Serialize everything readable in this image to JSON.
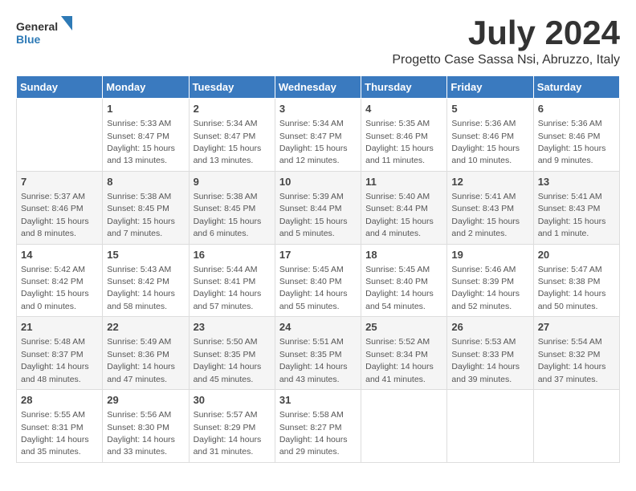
{
  "logo": {
    "line1": "General",
    "line2": "Blue"
  },
  "title": "July 2024",
  "subtitle": "Progetto Case Sassa Nsi, Abruzzo, Italy",
  "days_of_week": [
    "Sunday",
    "Monday",
    "Tuesday",
    "Wednesday",
    "Thursday",
    "Friday",
    "Saturday"
  ],
  "weeks": [
    [
      {
        "day": "",
        "info": ""
      },
      {
        "day": "1",
        "info": "Sunrise: 5:33 AM\nSunset: 8:47 PM\nDaylight: 15 hours\nand 13 minutes."
      },
      {
        "day": "2",
        "info": "Sunrise: 5:34 AM\nSunset: 8:47 PM\nDaylight: 15 hours\nand 13 minutes."
      },
      {
        "day": "3",
        "info": "Sunrise: 5:34 AM\nSunset: 8:47 PM\nDaylight: 15 hours\nand 12 minutes."
      },
      {
        "day": "4",
        "info": "Sunrise: 5:35 AM\nSunset: 8:46 PM\nDaylight: 15 hours\nand 11 minutes."
      },
      {
        "day": "5",
        "info": "Sunrise: 5:36 AM\nSunset: 8:46 PM\nDaylight: 15 hours\nand 10 minutes."
      },
      {
        "day": "6",
        "info": "Sunrise: 5:36 AM\nSunset: 8:46 PM\nDaylight: 15 hours\nand 9 minutes."
      }
    ],
    [
      {
        "day": "7",
        "info": "Sunrise: 5:37 AM\nSunset: 8:46 PM\nDaylight: 15 hours\nand 8 minutes."
      },
      {
        "day": "8",
        "info": "Sunrise: 5:38 AM\nSunset: 8:45 PM\nDaylight: 15 hours\nand 7 minutes."
      },
      {
        "day": "9",
        "info": "Sunrise: 5:38 AM\nSunset: 8:45 PM\nDaylight: 15 hours\nand 6 minutes."
      },
      {
        "day": "10",
        "info": "Sunrise: 5:39 AM\nSunset: 8:44 PM\nDaylight: 15 hours\nand 5 minutes."
      },
      {
        "day": "11",
        "info": "Sunrise: 5:40 AM\nSunset: 8:44 PM\nDaylight: 15 hours\nand 4 minutes."
      },
      {
        "day": "12",
        "info": "Sunrise: 5:41 AM\nSunset: 8:43 PM\nDaylight: 15 hours\nand 2 minutes."
      },
      {
        "day": "13",
        "info": "Sunrise: 5:41 AM\nSunset: 8:43 PM\nDaylight: 15 hours\nand 1 minute."
      }
    ],
    [
      {
        "day": "14",
        "info": "Sunrise: 5:42 AM\nSunset: 8:42 PM\nDaylight: 15 hours\nand 0 minutes."
      },
      {
        "day": "15",
        "info": "Sunrise: 5:43 AM\nSunset: 8:42 PM\nDaylight: 14 hours\nand 58 minutes."
      },
      {
        "day": "16",
        "info": "Sunrise: 5:44 AM\nSunset: 8:41 PM\nDaylight: 14 hours\nand 57 minutes."
      },
      {
        "day": "17",
        "info": "Sunrise: 5:45 AM\nSunset: 8:40 PM\nDaylight: 14 hours\nand 55 minutes."
      },
      {
        "day": "18",
        "info": "Sunrise: 5:45 AM\nSunset: 8:40 PM\nDaylight: 14 hours\nand 54 minutes."
      },
      {
        "day": "19",
        "info": "Sunrise: 5:46 AM\nSunset: 8:39 PM\nDaylight: 14 hours\nand 52 minutes."
      },
      {
        "day": "20",
        "info": "Sunrise: 5:47 AM\nSunset: 8:38 PM\nDaylight: 14 hours\nand 50 minutes."
      }
    ],
    [
      {
        "day": "21",
        "info": "Sunrise: 5:48 AM\nSunset: 8:37 PM\nDaylight: 14 hours\nand 48 minutes."
      },
      {
        "day": "22",
        "info": "Sunrise: 5:49 AM\nSunset: 8:36 PM\nDaylight: 14 hours\nand 47 minutes."
      },
      {
        "day": "23",
        "info": "Sunrise: 5:50 AM\nSunset: 8:35 PM\nDaylight: 14 hours\nand 45 minutes."
      },
      {
        "day": "24",
        "info": "Sunrise: 5:51 AM\nSunset: 8:35 PM\nDaylight: 14 hours\nand 43 minutes."
      },
      {
        "day": "25",
        "info": "Sunrise: 5:52 AM\nSunset: 8:34 PM\nDaylight: 14 hours\nand 41 minutes."
      },
      {
        "day": "26",
        "info": "Sunrise: 5:53 AM\nSunset: 8:33 PM\nDaylight: 14 hours\nand 39 minutes."
      },
      {
        "day": "27",
        "info": "Sunrise: 5:54 AM\nSunset: 8:32 PM\nDaylight: 14 hours\nand 37 minutes."
      }
    ],
    [
      {
        "day": "28",
        "info": "Sunrise: 5:55 AM\nSunset: 8:31 PM\nDaylight: 14 hours\nand 35 minutes."
      },
      {
        "day": "29",
        "info": "Sunrise: 5:56 AM\nSunset: 8:30 PM\nDaylight: 14 hours\nand 33 minutes."
      },
      {
        "day": "30",
        "info": "Sunrise: 5:57 AM\nSunset: 8:29 PM\nDaylight: 14 hours\nand 31 minutes."
      },
      {
        "day": "31",
        "info": "Sunrise: 5:58 AM\nSunset: 8:27 PM\nDaylight: 14 hours\nand 29 minutes."
      },
      {
        "day": "",
        "info": ""
      },
      {
        "day": "",
        "info": ""
      },
      {
        "day": "",
        "info": ""
      }
    ]
  ]
}
